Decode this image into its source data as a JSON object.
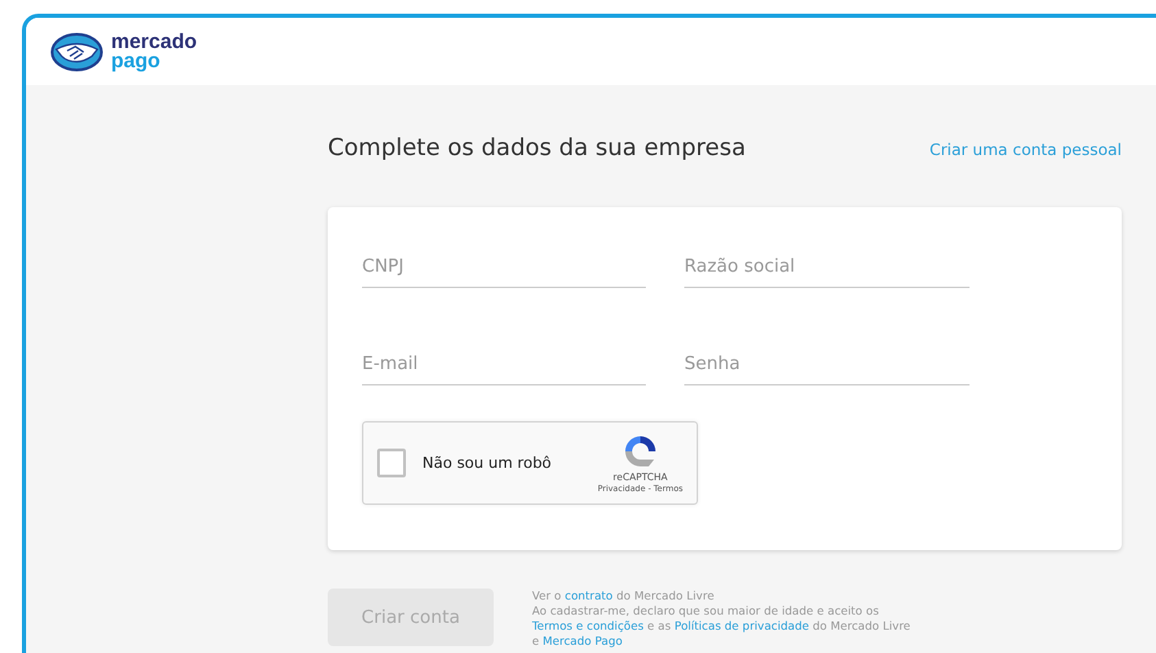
{
  "logo": {
    "line_1": "mercado",
    "line_2": "pago"
  },
  "title": "Complete os dados da sua empresa",
  "personal_link": "Criar uma conta pessoal",
  "fields": [
    {
      "placeholder": "CNPJ"
    },
    {
      "placeholder": "Razão social"
    },
    {
      "placeholder": "E-mail"
    },
    {
      "placeholder": "Senha"
    }
  ],
  "captcha": {
    "label": "Não sou um robô",
    "checked": false,
    "brand": "reCAPTCHA",
    "links": "Privacidade - Termos"
  },
  "submit": {
    "label": "Criar conta",
    "disabled": true
  },
  "legal": [
    [
      {
        "text": "Ver o ",
        "link": false
      },
      {
        "text": "contrato",
        "link": true
      },
      {
        "text": " do Mercado Livre",
        "link": false
      }
    ],
    [
      {
        "text": "Ao cadastrar-me, declaro que sou maior de idade e aceito os",
        "link": false
      }
    ],
    [
      {
        "text": "Termos e condições",
        "link": true
      },
      {
        "text": " e as ",
        "link": false
      },
      {
        "text": "Políticas de privacidade",
        "link": true
      },
      {
        "text": " do Mercado Livre",
        "link": false
      }
    ],
    [
      {
        "text": "e ",
        "link": false
      },
      {
        "text": "Mercado Pago",
        "link": true
      }
    ]
  ]
}
